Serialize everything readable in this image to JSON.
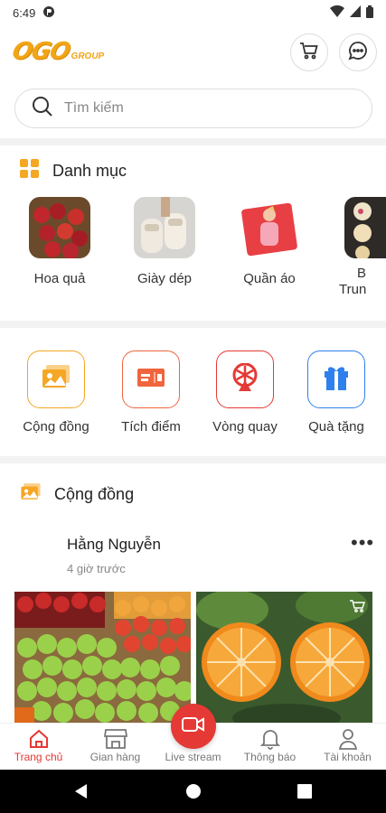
{
  "status_bar": {
    "time": "6:49"
  },
  "header": {
    "logo_text": "OGO",
    "logo_sub": "GROUP"
  },
  "search": {
    "placeholder": "Tìm kiếm"
  },
  "categories": {
    "title": "Danh mục",
    "items": [
      {
        "label": "Hoa quả"
      },
      {
        "label": "Giày dép"
      },
      {
        "label": "Quần áo"
      },
      {
        "label": "B",
        "label2": "Trun"
      }
    ]
  },
  "features": [
    {
      "label": "Cộng đồng",
      "color": "#f5a623"
    },
    {
      "label": "Tích điểm",
      "color": "#f0653d"
    },
    {
      "label": "Vòng quay",
      "color": "#e53935"
    },
    {
      "label": "Quà tặng",
      "color": "#2f80ed"
    }
  ],
  "community": {
    "title": "Cộng đồng",
    "post": {
      "author": "Hằng Nguyễn",
      "time": "4 giờ trước",
      "more": "•••"
    }
  },
  "bottom_nav": {
    "items": [
      {
        "label": "Trang chủ",
        "active": true
      },
      {
        "label": "Gian hàng"
      },
      {
        "label": "Live stream"
      },
      {
        "label": "Thông báo"
      },
      {
        "label": "Tài khoản"
      }
    ]
  },
  "colors": {
    "accent": "#e53935",
    "brand": "#f2a516"
  }
}
